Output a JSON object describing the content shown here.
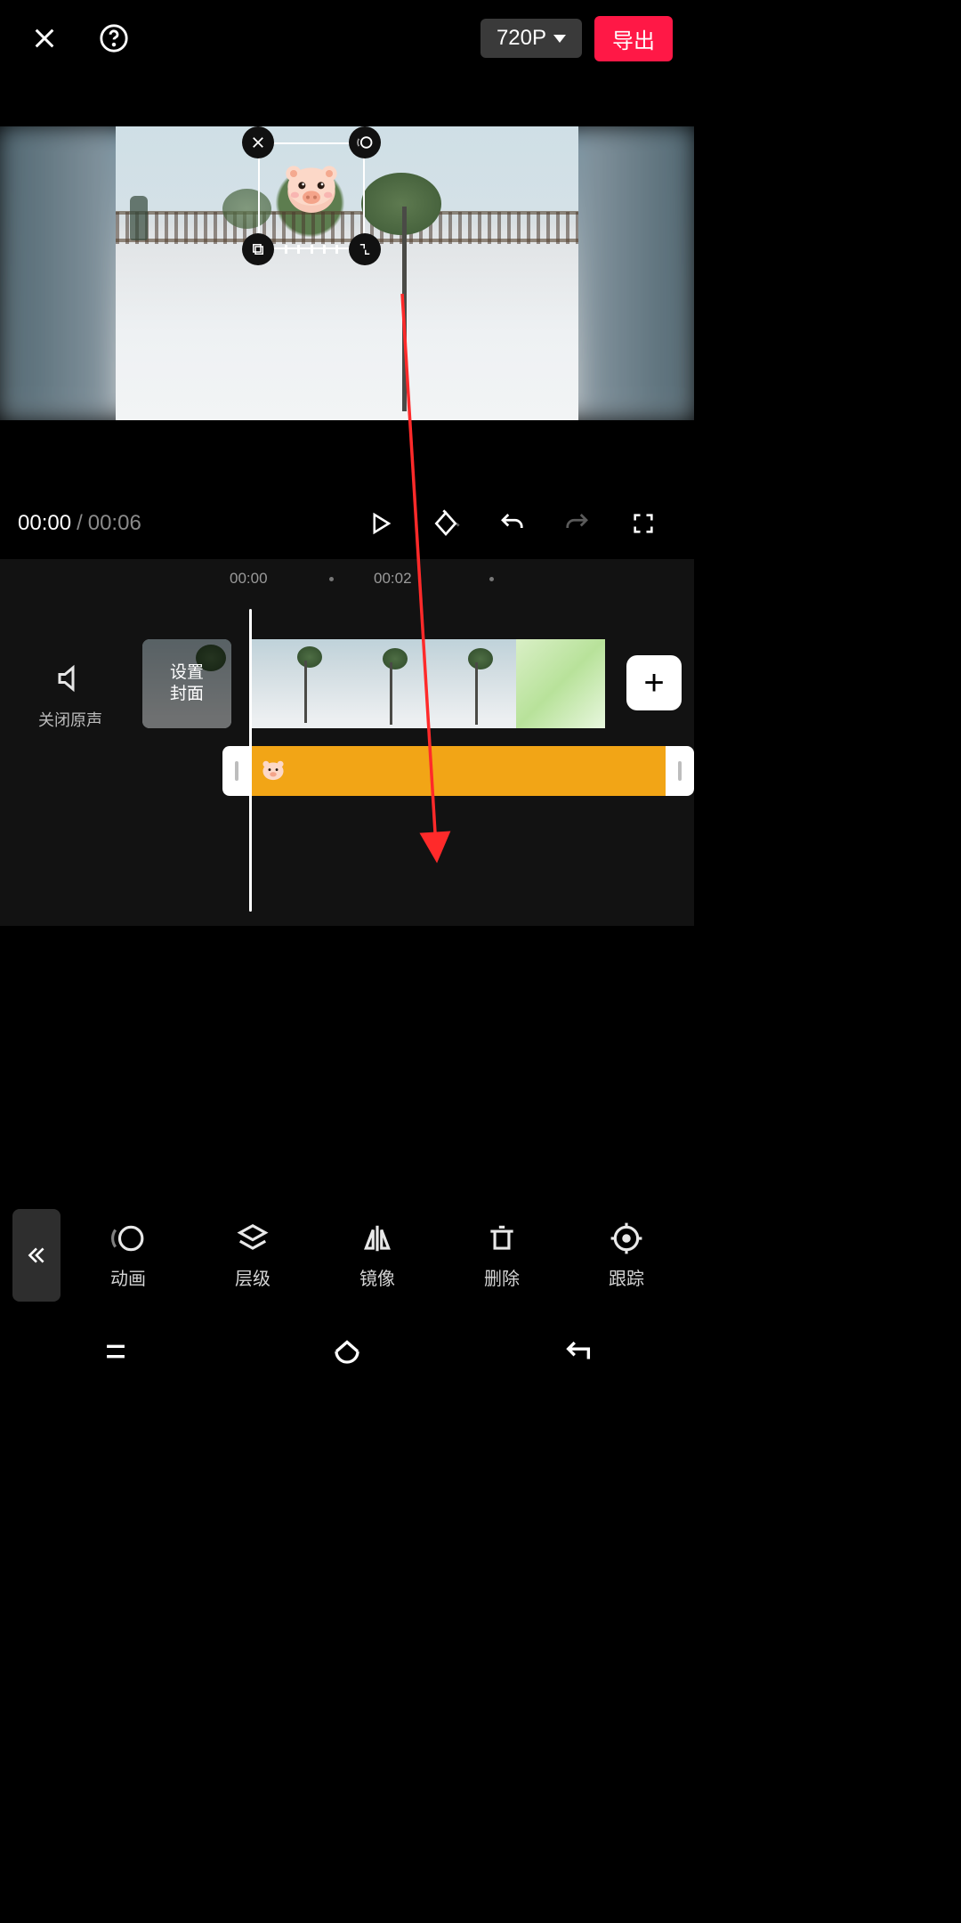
{
  "header": {
    "resolution_label": "720P",
    "export_label": "导出"
  },
  "preview": {
    "sticker_name": "pig-sticker"
  },
  "transport": {
    "current_time": "00:00",
    "separator": "/",
    "total_time": "00:06"
  },
  "timeline": {
    "ruler": {
      "t0": "00:00",
      "t1": "00:02"
    },
    "mute_label": "关闭原声",
    "cover_label_line1": "设置",
    "cover_label_line2": "封面"
  },
  "toolbar": {
    "items": [
      {
        "id": "animation",
        "label": "动画"
      },
      {
        "id": "layer",
        "label": "层级"
      },
      {
        "id": "mirror",
        "label": "镜像"
      },
      {
        "id": "delete",
        "label": "删除"
      },
      {
        "id": "track",
        "label": "跟踪"
      }
    ]
  }
}
